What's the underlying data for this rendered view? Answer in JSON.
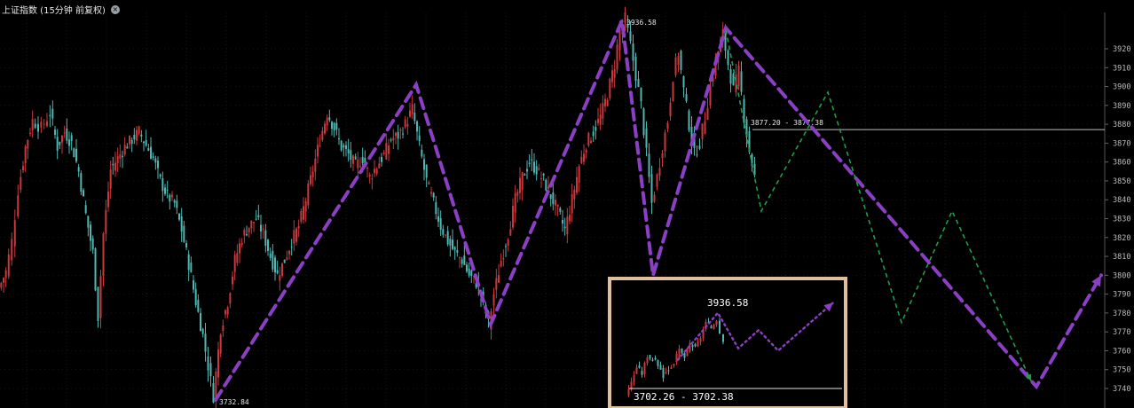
{
  "header": {
    "title": "上证指数 (15分钟 前复权)",
    "close_glyph": "×"
  },
  "colors": {
    "background": "#000000",
    "up_candle": "#c8383c",
    "down_candle": "#4fb6b2",
    "zigzag": "#8a3fc4",
    "projection": "#1f9e4a",
    "axis_text": "#bcbcbc",
    "grid": "#2a2a2a",
    "inset_border": "#e0c09a",
    "reference_line": "#bfbfbf"
  },
  "chart_data": [
    {
      "type": "candlestick",
      "title": "上证指数 (15分钟 前复权)",
      "ylim": [
        3732,
        3938
      ],
      "y_ticks": [
        3740,
        3750,
        3760,
        3770,
        3780,
        3790,
        3800,
        3810,
        3820,
        3830,
        3840,
        3850,
        3860,
        3870,
        3880,
        3890,
        3900,
        3910,
        3920
      ],
      "grid": true,
      "price_path": [
        [
          0,
          3793
        ],
        [
          8,
          3802
        ],
        [
          15,
          3818
        ],
        [
          22,
          3845
        ],
        [
          30,
          3868
        ],
        [
          38,
          3882
        ],
        [
          48,
          3878
        ],
        [
          58,
          3886
        ],
        [
          66,
          3868
        ],
        [
          74,
          3876
        ],
        [
          82,
          3870
        ],
        [
          90,
          3855
        ],
        [
          98,
          3832
        ],
        [
          106,
          3812
        ],
        [
          112,
          3778
        ],
        [
          118,
          3822
        ],
        [
          126,
          3856
        ],
        [
          134,
          3862
        ],
        [
          142,
          3868
        ],
        [
          150,
          3872
        ],
        [
          158,
          3876
        ],
        [
          166,
          3869
        ],
        [
          174,
          3862
        ],
        [
          182,
          3850
        ],
        [
          190,
          3842
        ],
        [
          198,
          3838
        ],
        [
          206,
          3824
        ],
        [
          214,
          3806
        ],
        [
          222,
          3786
        ],
        [
          230,
          3768
        ],
        [
          236,
          3752
        ],
        [
          242,
          3736
        ],
        [
          250,
          3772
        ],
        [
          258,
          3786
        ],
        [
          266,
          3808
        ],
        [
          274,
          3820
        ],
        [
          282,
          3826
        ],
        [
          290,
          3830
        ],
        [
          298,
          3822
        ],
        [
          306,
          3810
        ],
        [
          314,
          3800
        ],
        [
          322,
          3808
        ],
        [
          330,
          3818
        ],
        [
          338,
          3826
        ],
        [
          346,
          3840
        ],
        [
          354,
          3856
        ],
        [
          362,
          3872
        ],
        [
          370,
          3886
        ],
        [
          378,
          3878
        ],
        [
          386,
          3868
        ],
        [
          394,
          3864
        ],
        [
          402,
          3858
        ],
        [
          410,
          3862
        ],
        [
          418,
          3852
        ],
        [
          426,
          3858
        ],
        [
          434,
          3864
        ],
        [
          442,
          3872
        ],
        [
          450,
          3874
        ],
        [
          458,
          3880
        ],
        [
          466,
          3888
        ],
        [
          474,
          3868
        ],
        [
          482,
          3850
        ],
        [
          490,
          3838
        ],
        [
          498,
          3826
        ],
        [
          506,
          3818
        ],
        [
          514,
          3812
        ],
        [
          522,
          3808
        ],
        [
          530,
          3800
        ],
        [
          538,
          3796
        ],
        [
          546,
          3786
        ],
        [
          552,
          3774
        ],
        [
          558,
          3790
        ],
        [
          566,
          3808
        ],
        [
          574,
          3822
        ],
        [
          582,
          3840
        ],
        [
          590,
          3852
        ],
        [
          598,
          3860
        ],
        [
          606,
          3856
        ],
        [
          614,
          3850
        ],
        [
          622,
          3842
        ],
        [
          630,
          3834
        ],
        [
          638,
          3824
        ],
        [
          646,
          3840
        ],
        [
          654,
          3858
        ],
        [
          662,
          3870
        ],
        [
          670,
          3876
        ],
        [
          678,
          3884
        ],
        [
          686,
          3896
        ],
        [
          694,
          3912
        ],
        [
          700,
          3930
        ],
        [
          706,
          3936
        ],
        [
          712,
          3922
        ],
        [
          718,
          3906
        ],
        [
          724,
          3890
        ],
        [
          730,
          3864
        ],
        [
          736,
          3838
        ],
        [
          742,
          3852
        ],
        [
          748,
          3868
        ],
        [
          754,
          3882
        ],
        [
          760,
          3906
        ],
        [
          766,
          3918
        ],
        [
          772,
          3898
        ],
        [
          778,
          3880
        ],
        [
          784,
          3864
        ],
        [
          790,
          3870
        ],
        [
          796,
          3884
        ],
        [
          802,
          3900
        ],
        [
          808,
          3914
        ],
        [
          816,
          3928
        ],
        [
          822,
          3912
        ],
        [
          828,
          3898
        ],
        [
          834,
          3908
        ],
        [
          840,
          3884
        ],
        [
          846,
          3866
        ],
        [
          852,
          3852
        ]
      ],
      "zigzag": [
        [
          243,
          3734
        ],
        [
          469,
          3901
        ],
        [
          553,
          3774
        ],
        [
          701,
          3935
        ],
        [
          736,
          3800
        ],
        [
          818,
          3931
        ],
        [
          1168,
          3741
        ],
        [
          1241,
          3800
        ]
      ],
      "projection": [
        [
          818,
          3930
        ],
        [
          858,
          3834
        ],
        [
          933,
          3897
        ],
        [
          1016,
          3775
        ],
        [
          1073,
          3834
        ],
        [
          1162,
          3744
        ]
      ],
      "annotations": {
        "high_label": "3936.58",
        "low_label": "3732.84",
        "ref_label": "3877.20 - 3877.38",
        "ref_level": 3877.2
      }
    },
    {
      "type": "candlestick",
      "inset": true,
      "price_path": [
        [
          0,
          3706
        ],
        [
          6,
          3716
        ],
        [
          12,
          3730
        ],
        [
          18,
          3724
        ],
        [
          24,
          3740
        ],
        [
          30,
          3736
        ],
        [
          36,
          3732
        ],
        [
          42,
          3722
        ],
        [
          48,
          3728
        ],
        [
          54,
          3734
        ],
        [
          60,
          3744
        ],
        [
          66,
          3738
        ],
        [
          72,
          3750
        ],
        [
          78,
          3746
        ],
        [
          84,
          3756
        ],
        [
          90,
          3768
        ],
        [
          96,
          3764
        ],
        [
          102,
          3772
        ],
        [
          106,
          3760
        ],
        [
          110,
          3754
        ]
      ],
      "ylim": [
        3700,
        3790
      ],
      "zigzag": [
        [
          57,
          3736
        ],
        [
          102,
          3777
        ],
        [
          125,
          3746
        ],
        [
          148,
          3762
        ],
        [
          170,
          3744
        ],
        [
          232,
          3786
        ]
      ],
      "annotations": {
        "high_label": "3936.58",
        "bottom_label": "3702.26 - 3702.38"
      }
    }
  ]
}
